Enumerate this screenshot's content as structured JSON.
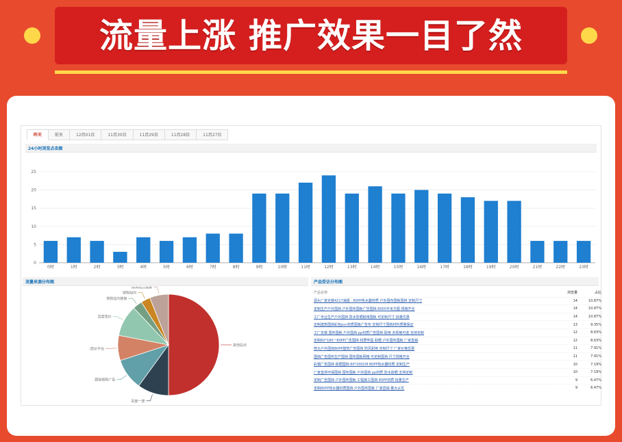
{
  "banner": {
    "headline": "流量上涨 推广效果一目了然",
    "colors": {
      "background": "#e84a2e",
      "banner": "#d51f1f",
      "accent": "#ffd84a"
    }
  },
  "tabs": [
    {
      "label": "昨天",
      "active": true
    },
    {
      "label": "前天",
      "active": false
    },
    {
      "label": "12月01日",
      "active": false
    },
    {
      "label": "11月30日",
      "active": false
    },
    {
      "label": "11月29日",
      "active": false
    },
    {
      "label": "11月28日",
      "active": false
    },
    {
      "label": "11月27日",
      "active": false
    }
  ],
  "sections": {
    "hourly_title": "24小时浏览点击图",
    "source_title": "流量来源分布图",
    "product_title": "产品受访分布图"
  },
  "table": {
    "headers": {
      "name": "产品名称",
      "views": "浏览量",
      "ratio": "占比"
    },
    "rows": [
      {
        "name": "源头厂家定做4217海报 · 80PP热水器材质 户外围布围板围挡 定制尺寸",
        "views": "14",
        "ratio": "10.87%"
      },
      {
        "name": "定制生产户外围挡 户外围布围板广告围挡 8000平米方图 规格齐全",
        "views": "14",
        "ratio": "10.87%"
      },
      {
        "name": "工厂专业生产户外围挡 防水防晒耐用围板 可定制尺寸 批量优惠",
        "views": "14",
        "ratio": "10.87%"
      },
      {
        "name": "定制建筑围挡彩色pvc材质围板广告布 定制尺寸围挡材料质量保证",
        "views": "13",
        "ratio": "9.35%"
      },
      {
        "name": "工厂定做 围布围板 户外围挡 pp材质广告围挡 耐用 多规格可选 支持定制",
        "views": "12",
        "ratio": "8.63%"
      },
      {
        "name": "定制60*180一80PP广告围挡 材质牢固 耐晒 户外围布围板 厂家直销",
        "views": "12",
        "ratio": "8.63%"
      },
      {
        "name": "修大户外围挡80PP建筑广告围挡 防风耐用 定制尺寸 厂家价格优惠",
        "views": "11",
        "ratio": "7.91%"
      },
      {
        "name": "围挡广告围布生产围挡 围布围板网格 可定制围挡 尺寸规格齐全",
        "views": "11",
        "ratio": "7.91%"
      },
      {
        "name": "彩钢广告围挡 耐晒围挡 80*200CM 80PP热水器材质 定制生产",
        "views": "10",
        "ratio": "7.19%"
      },
      {
        "name": "厂家直供环保围挡 围布围板 户外围挡 pp材质 防水耐晒 支持定制",
        "views": "10",
        "ratio": "7.19%"
      },
      {
        "name": "定制广告围挡 户外围布围板 工程施工围挡 80PP材质 批量生产",
        "views": "9",
        "ratio": "6.47%"
      },
      {
        "name": "定制80PP热水器材质围挡 户外围布围板 厂家直销 量大从优",
        "views": "9",
        "ratio": "6.47%"
      }
    ]
  },
  "chart_data": [
    {
      "type": "bar",
      "title": "24小时浏览点击图",
      "categories": [
        "0时",
        "1时",
        "2时",
        "3时",
        "4时",
        "5时",
        "6时",
        "7时",
        "8时",
        "9时",
        "10时",
        "11时",
        "12时",
        "13时",
        "14时",
        "15时",
        "16时",
        "17时",
        "18时",
        "19时",
        "20时",
        "21时",
        "22时",
        "23时"
      ],
      "values": [
        6,
        7,
        6,
        3,
        7,
        6,
        7,
        8,
        8,
        19,
        19,
        22,
        24,
        19,
        21,
        19,
        20,
        19,
        18,
        17,
        17,
        6,
        6,
        6
      ],
      "yticks": [
        0,
        5,
        10,
        15,
        20,
        25
      ],
      "ylim": [
        0,
        25
      ],
      "grid": true,
      "color": "#1f7fd0"
    },
    {
      "type": "pie",
      "title": "流量来源分布图",
      "slices": [
        {
          "label": "其他站点",
          "value": 50,
          "color": "#c1302c"
        },
        {
          "label": "百度一搜",
          "value": 10,
          "color": "#2e4150"
        },
        {
          "label": "超级搜狗广告",
          "value": 10,
          "color": "#61a0a8"
        },
        {
          "label": "搜狗竞价平台",
          "value": 8,
          "color": "#d48265"
        },
        {
          "label": "百度竞价",
          "value": 10,
          "color": "#91c7ae"
        },
        {
          "label": "搜狗站内链接",
          "value": 3,
          "color": "#749f83"
        },
        {
          "label": "搜狗站内",
          "value": 3,
          "color": "#ca8622"
        },
        {
          "label": "搜狗站点链接",
          "value": 6,
          "color": "#bda29a"
        }
      ]
    }
  ]
}
